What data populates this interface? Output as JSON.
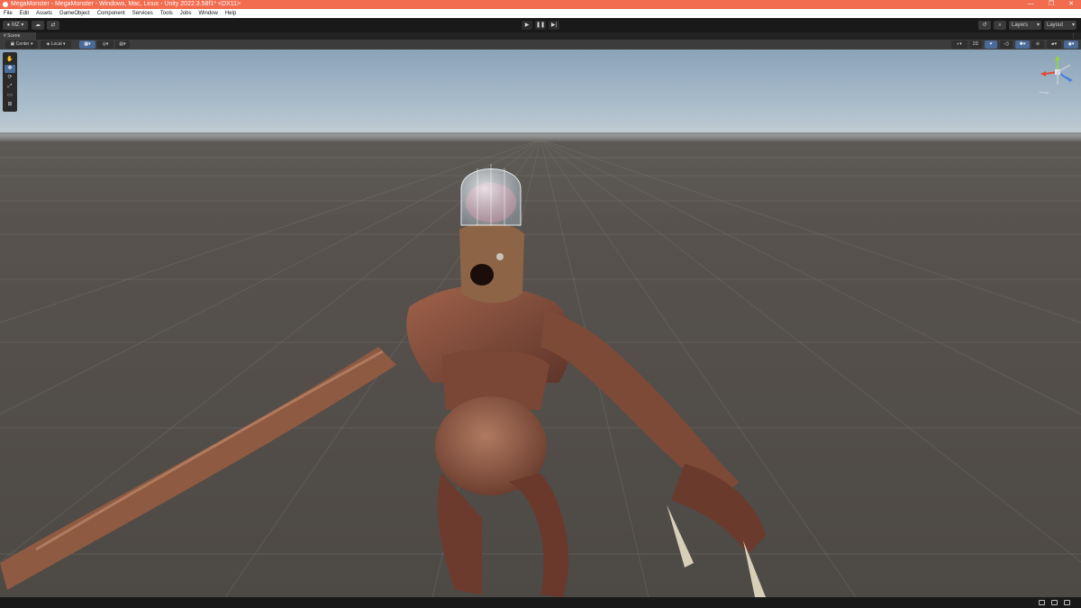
{
  "window": {
    "title": "MegaMonster - MegaMonster - Windows, Mac, Linux - Unity 2022.3.58f1* <DX11>",
    "controls": [
      "—",
      "❐",
      "✕"
    ]
  },
  "menubar": {
    "items": [
      "File",
      "Edit",
      "Assets",
      "GameObject",
      "Component",
      "Services",
      "Tools",
      "Jobs",
      "Window",
      "Help"
    ]
  },
  "toolbar": {
    "account_label": "MZ",
    "layers_label": "Layers",
    "layout_label": "Layout"
  },
  "scene": {
    "tab_label": "Scene",
    "pivot_label": "Center",
    "space_label": "Local",
    "mode_2d": "2D",
    "gizmo_label": "Persp"
  },
  "icons": {
    "play": "play-icon",
    "pause": "pause-icon",
    "step": "step-icon",
    "hand": "hand-tool-icon",
    "move": "move-tool-icon",
    "rotate": "rotate-tool-icon",
    "scale": "scale-tool-icon",
    "rect": "rect-tool-icon",
    "transform": "transform-tool-icon"
  },
  "colors": {
    "title_bar": "#f26c4f",
    "editor_dark": "#191919",
    "panel": "#3c3c3c",
    "active_blue": "#4a6b98",
    "gizmo_x": "#e04a3a",
    "gizmo_y": "#8ed14a",
    "gizmo_z": "#4a7ee0"
  }
}
